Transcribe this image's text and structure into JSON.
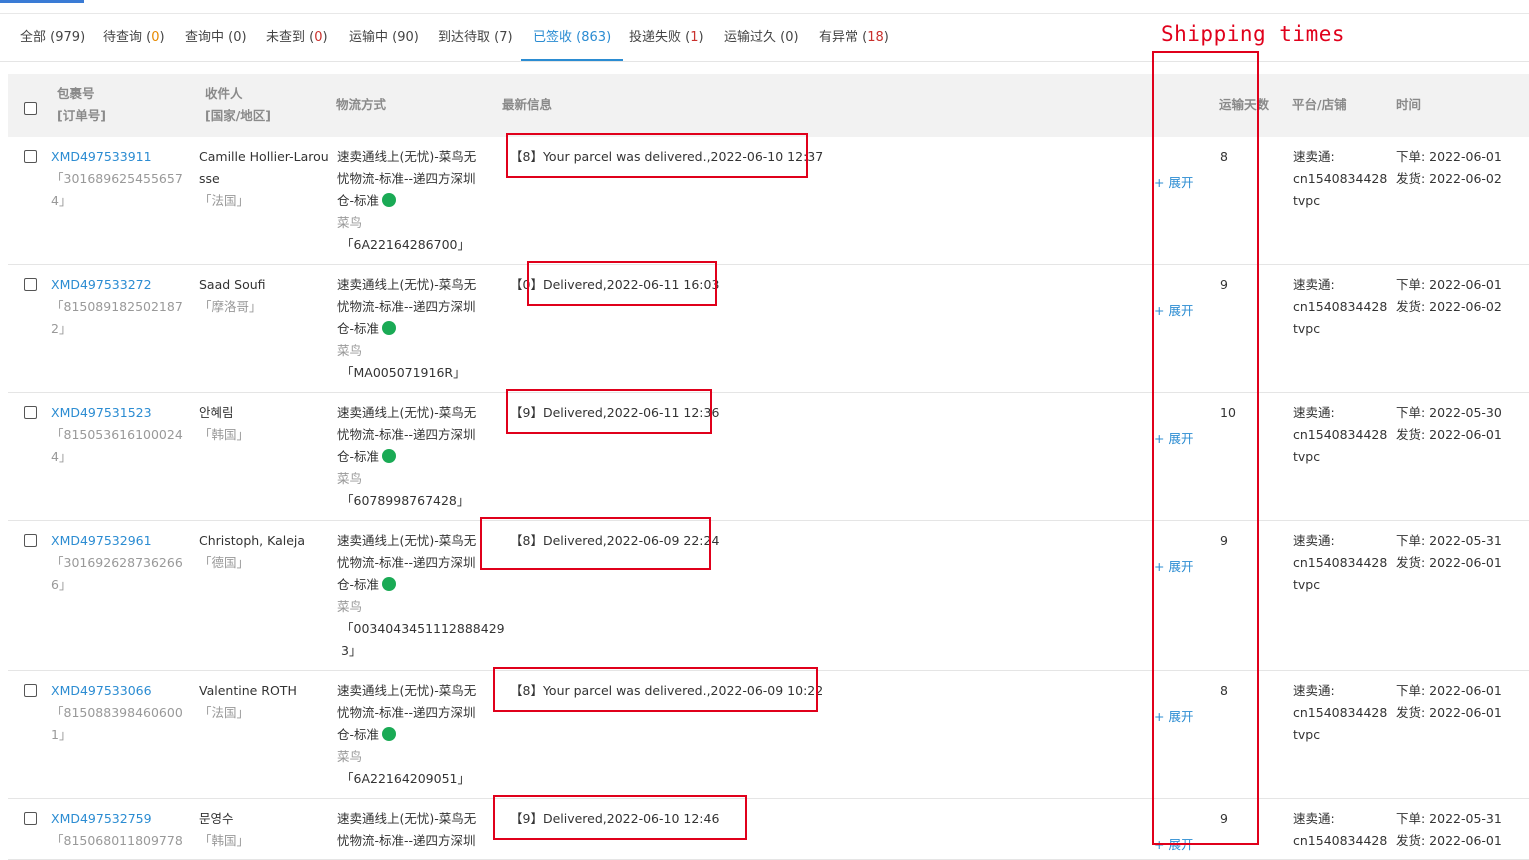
{
  "tabs": [
    {
      "label": "全部",
      "count": "979",
      "count_color": "plain",
      "active": false
    },
    {
      "label": "待查询",
      "count": "0",
      "count_color": "orange",
      "active": false
    },
    {
      "label": "查询中",
      "count": "0",
      "count_color": "plain",
      "active": false
    },
    {
      "label": "未查到",
      "count": "0",
      "count_color": "red",
      "active": false
    },
    {
      "label": "运输中",
      "count": "90",
      "count_color": "plain",
      "active": false
    },
    {
      "label": "到达待取",
      "count": "7",
      "count_color": "plain",
      "active": false
    },
    {
      "label": "已签收",
      "count": "863",
      "count_color": "plain",
      "active": true
    },
    {
      "label": "投递失败",
      "count": "1",
      "count_color": "red",
      "active": false
    },
    {
      "label": "运输过久",
      "count": "0",
      "count_color": "plain",
      "active": false
    },
    {
      "label": "有异常",
      "count": "18",
      "count_color": "red",
      "active": false
    }
  ],
  "annotation": {
    "text": "Shipping times",
    "color": "#e0001b"
  },
  "table": {
    "headers": {
      "parcel": "包裹号",
      "order": "[订单号]",
      "recipient": "收件人",
      "region": "[国家/地区]",
      "logistics": "物流方式",
      "latest": "最新信息",
      "days": "运输天数",
      "platform": "平台/店铺",
      "time": "时间"
    },
    "expand_label": "+ 展开",
    "rows": [
      {
        "parcel": "XMD497533911",
        "order_lines": [
          "「301689625455657",
          "4」"
        ],
        "recipient_lines": [
          "Camille Hollier-Larou",
          "sse"
        ],
        "country": "「法国」",
        "logistics_lines": [
          "速卖通线上(无忧)-菜鸟无",
          "忧物流-标准--递四方深圳",
          "仓-标准"
        ],
        "carrier": "菜鸟",
        "tracking_lines": [
          "「6A22164286700」"
        ],
        "info": "【8】Your parcel was delivered.,2022-06-10 12:37",
        "days": "8",
        "platform_lines": [
          "速卖通:",
          "cn1540834428",
          "tvpc"
        ],
        "time_lines": [
          "下单: 2022-06-01",
          "发货: 2022-06-02"
        ]
      },
      {
        "parcel": "XMD497533272",
        "order_lines": [
          "「815089182502187",
          "2」"
        ],
        "recipient_lines": [
          "Saad Soufi"
        ],
        "country": "「摩洛哥」",
        "logistics_lines": [
          "速卖通线上(无忧)-菜鸟无",
          "忧物流-标准--递四方深圳",
          "仓-标准"
        ],
        "carrier": "菜鸟",
        "tracking_lines": [
          "「MA005071916R」"
        ],
        "info": "【0】Delivered,2022-06-11 16:03",
        "days": "9",
        "platform_lines": [
          "速卖通:",
          "cn1540834428",
          "tvpc"
        ],
        "time_lines": [
          "下单: 2022-06-01",
          "发货: 2022-06-02"
        ]
      },
      {
        "parcel": "XMD497531523",
        "order_lines": [
          "「815053616100024",
          "4」"
        ],
        "recipient_lines": [
          "안혜림"
        ],
        "country": "「韩国」",
        "logistics_lines": [
          "速卖通线上(无忧)-菜鸟无",
          "忧物流-标准--递四方深圳",
          "仓-标准"
        ],
        "carrier": "菜鸟",
        "tracking_lines": [
          "「6078998767428」"
        ],
        "info": "【9】Delivered,2022-06-11 12:36",
        "days": "10",
        "platform_lines": [
          "速卖通:",
          "cn1540834428",
          "tvpc"
        ],
        "time_lines": [
          "下单: 2022-05-30",
          "发货: 2022-06-01"
        ]
      },
      {
        "parcel": "XMD497532961",
        "order_lines": [
          "「301692628736266",
          "6」"
        ],
        "recipient_lines": [
          "Christoph, Kaleja"
        ],
        "country": "「德国」",
        "logistics_lines": [
          "速卖通线上(无忧)-菜鸟无",
          "忧物流-标准--递四方深圳",
          "仓-标准"
        ],
        "carrier": "菜鸟",
        "tracking_lines": [
          "「0034043451112888429",
          "3」"
        ],
        "info": "【8】Delivered,2022-06-09 22:24",
        "days": "9",
        "platform_lines": [
          "速卖通:",
          "cn1540834428",
          "tvpc"
        ],
        "time_lines": [
          "下单: 2022-05-31",
          "发货: 2022-06-01"
        ]
      },
      {
        "parcel": "XMD497533066",
        "order_lines": [
          "「815088398460600",
          "1」"
        ],
        "recipient_lines": [
          "Valentine ROTH"
        ],
        "country": "「法国」",
        "logistics_lines": [
          "速卖通线上(无忧)-菜鸟无",
          "忧物流-标准--递四方深圳",
          "仓-标准"
        ],
        "carrier": "菜鸟",
        "tracking_lines": [
          "「6A22164209051」"
        ],
        "info": "【8】Your parcel was delivered.,2022-06-09 10:22",
        "days": "8",
        "platform_lines": [
          "速卖通:",
          "cn1540834428",
          "tvpc"
        ],
        "time_lines": [
          "下单: 2022-06-01",
          "发货: 2022-06-01"
        ]
      },
      {
        "parcel": "XMD497532759",
        "order_lines": [
          "「815068011809778"
        ],
        "recipient_lines": [
          "문영수"
        ],
        "country": "「韩国」",
        "logistics_lines": [
          "速卖通线上(无忧)-菜鸟无",
          "忧物流-标准--递四方深圳"
        ],
        "carrier": "",
        "tracking_lines": [],
        "info": "【9】Delivered,2022-06-10 12:46",
        "days": "9",
        "platform_lines": [
          "速卖通:",
          "cn1540834428"
        ],
        "time_lines": [
          "下单: 2022-05-31",
          "发货: 2022-06-01"
        ]
      }
    ]
  }
}
